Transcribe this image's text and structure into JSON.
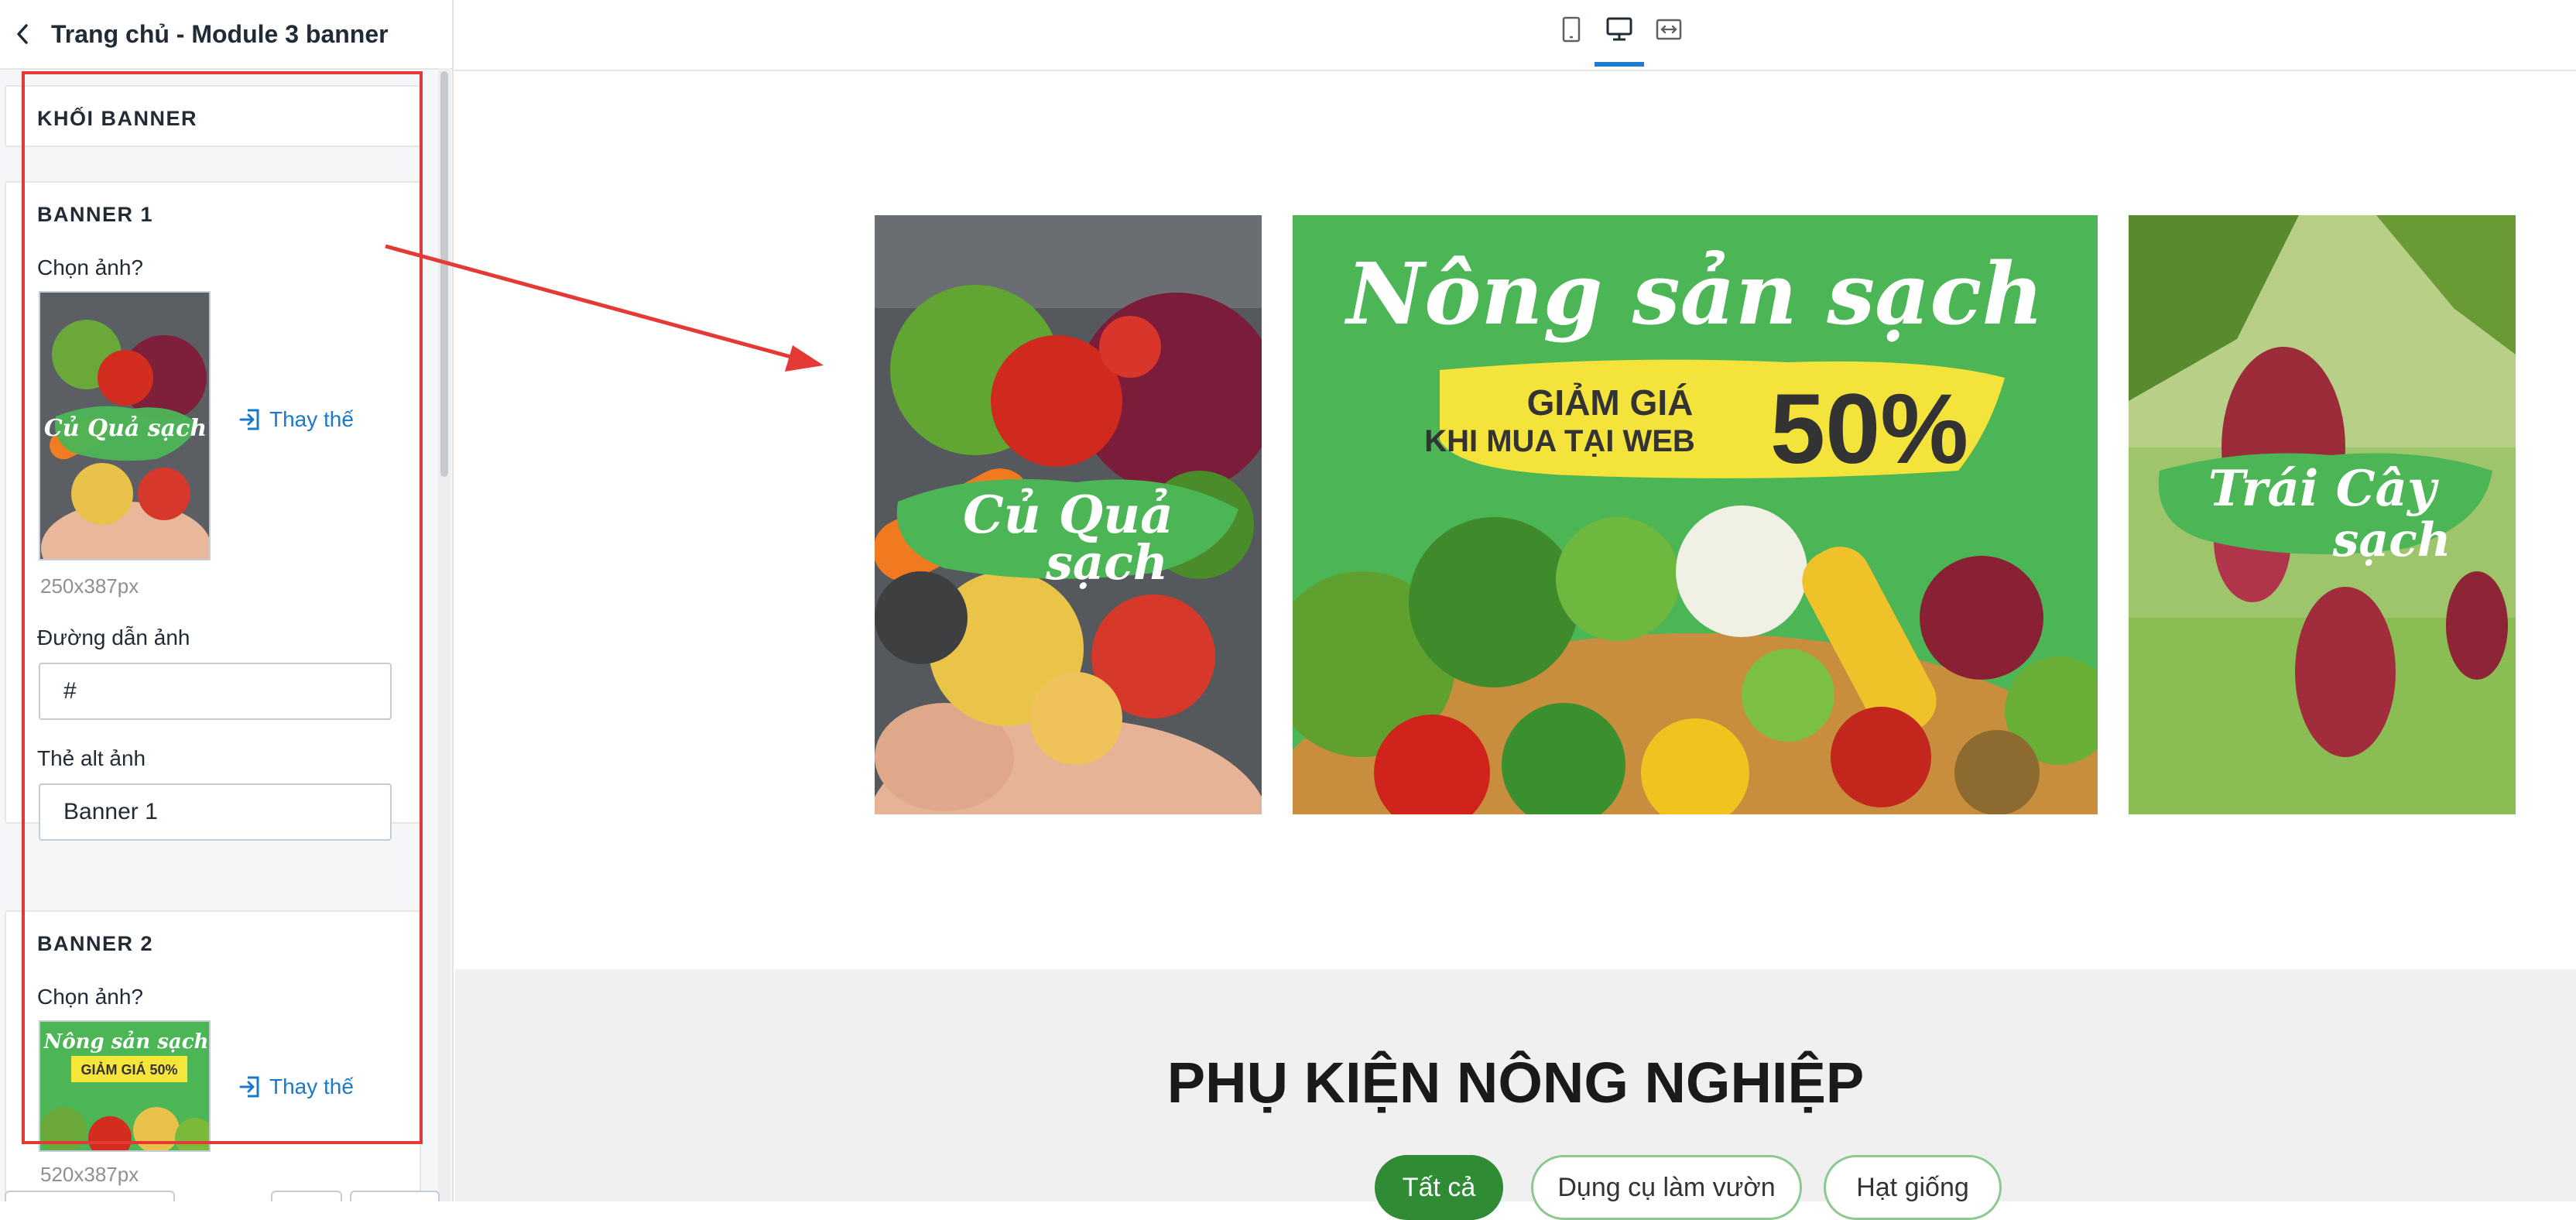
{
  "header": {
    "title": "Trang chủ - Module 3 banner"
  },
  "sidebar": {
    "block_title": "KHỐI BANNER",
    "banner1": {
      "heading": "BANNER 1",
      "choose_label": "Chọn ảnh?",
      "replace_label": "Thay thế",
      "dimensions": "250x387px",
      "link_label": "Đường dẫn ảnh",
      "link_value": "#",
      "alt_label": "Thẻ alt ảnh",
      "alt_value": "Banner 1",
      "thumb_text": "Củ Quả sạch"
    },
    "banner2": {
      "heading": "BANNER 2",
      "choose_label": "Chọn ảnh?",
      "replace_label": "Thay thế",
      "dimensions": "520x387px",
      "thumb_title": "Nông sản sạch",
      "thumb_sub": "GIẢM GIÁ 50%"
    }
  },
  "preview": {
    "banner1": {
      "text_line1": "Củ Quả",
      "text_line2": "sạch"
    },
    "banner2": {
      "title": "Nông sản sạch",
      "promo_line1": "GIẢM GIÁ",
      "promo_line2": "KHI MUA TẠI WEB",
      "promo_value": "50%"
    },
    "banner3": {
      "text_line1": "Trái Cây",
      "text_line2": "sạch"
    },
    "section_title": "PHỤ KIỆN NÔNG NGHIỆP",
    "tabs": [
      "Tất cả",
      "Dụng cụ làm vườn",
      "Hạt giống"
    ]
  },
  "colors": {
    "accent": "#1f7bd1",
    "highlight": "#e53935",
    "green_brand": "#2f8c35",
    "banner_green": "#4cb556"
  }
}
